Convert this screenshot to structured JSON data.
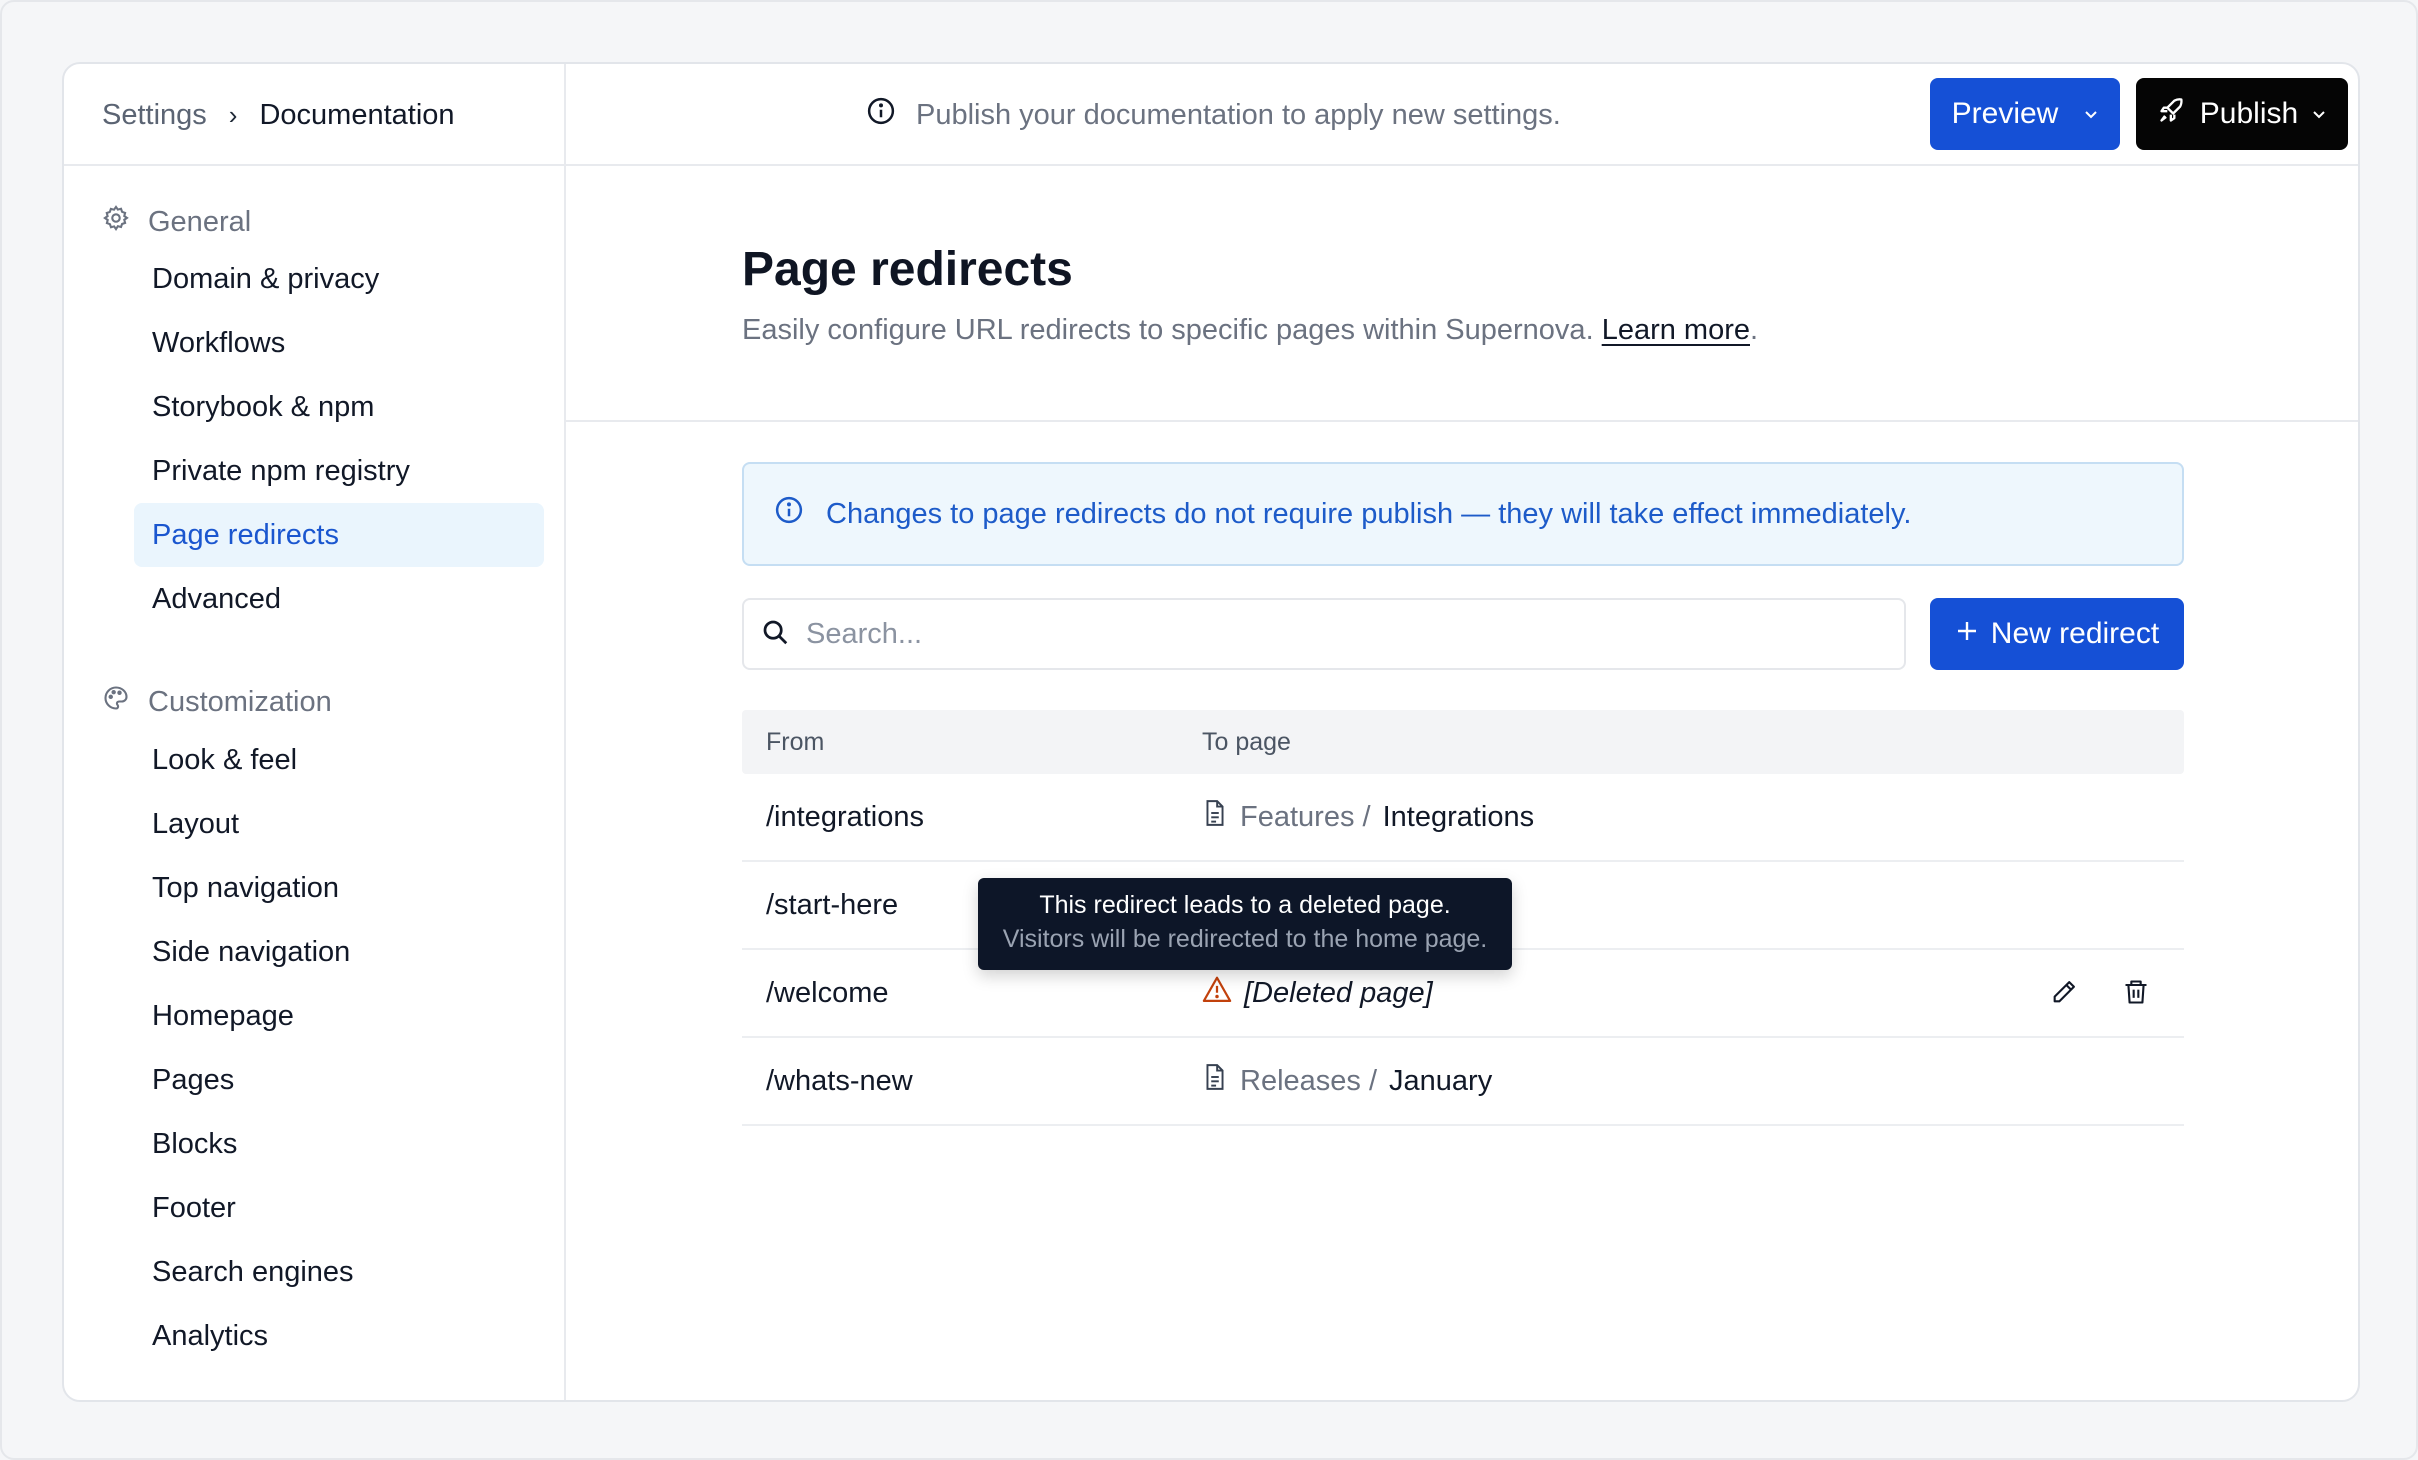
{
  "breadcrumb": {
    "root": "Settings",
    "separator": "›",
    "current": "Documentation"
  },
  "topbar": {
    "notice": "Publish your documentation to apply new settings.",
    "preview_label": "Preview",
    "publish_label": "Publish"
  },
  "sidebar": {
    "general": {
      "title": "General",
      "items": [
        "Domain & privacy",
        "Workflows",
        "Storybook & npm",
        "Private npm registry",
        "Page redirects",
        "Advanced"
      ],
      "active": "Page redirects"
    },
    "customization": {
      "title": "Customization",
      "items": [
        "Look & feel",
        "Layout",
        "Top navigation",
        "Side navigation",
        "Homepage",
        "Pages",
        "Blocks",
        "Footer",
        "Search engines",
        "Analytics"
      ]
    }
  },
  "main": {
    "title": "Page redirects",
    "subtitle": "Easily configure URL redirects to specific pages within Supernova.",
    "learn_more": "Learn more",
    "subtitle_end": ".",
    "info": "Changes to page redirects do not require publish — they will take effect immediately.",
    "search_placeholder": "Search...",
    "new_redirect_label": "New redirect",
    "table": {
      "headers": [
        "From",
        "To page"
      ],
      "rows": [
        {
          "from": "/integrations",
          "parent": "Features",
          "separator": "/",
          "page": "Integrations"
        },
        {
          "from": "/start-here"
        },
        {
          "from": "/welcome",
          "deleted": "[Deleted page]"
        },
        {
          "from": "/whats-new",
          "parent": "Releases",
          "separator": "/",
          "page": "January"
        }
      ]
    },
    "tooltip": {
      "line1": "This redirect leads to a deleted page.",
      "line2": "Visitors will be redirected to the home page."
    }
  },
  "colors": {
    "primary": "#1550d6",
    "publish": "#050505",
    "active_bg": "#eaf5fd",
    "active_text": "#1a56cf",
    "info_bg": "#eef7fd",
    "warning": "#c2410c",
    "tooltip_bg": "#0d1628"
  },
  "icons": [
    "info-icon",
    "chevron-down-icon",
    "rocket-icon",
    "gear-icon",
    "palette-icon",
    "search-icon",
    "plus-icon",
    "document-icon",
    "warning-icon",
    "pencil-icon",
    "trash-icon"
  ]
}
